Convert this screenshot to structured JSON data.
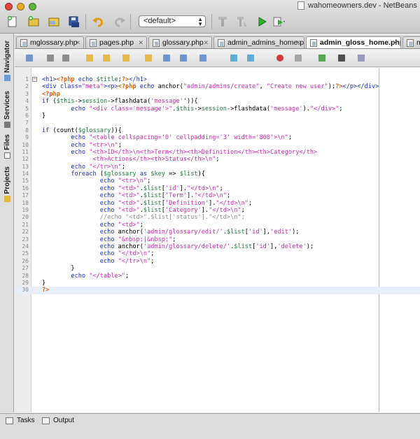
{
  "window": {
    "title": "wahomeowners.dev - NetBeans I"
  },
  "toolbar": {
    "config": "<default>",
    "icons": [
      "new-file-icon",
      "new-project-icon",
      "open-project-icon",
      "save-all-icon",
      "undo-icon",
      "redo-icon",
      "build-icon",
      "clean-build-icon",
      "run-icon",
      "debug-icon"
    ]
  },
  "sidebar": {
    "tabs": [
      "Navigator",
      "Services",
      "Files",
      "Projects"
    ]
  },
  "tabs": [
    {
      "label": "mglossary.php",
      "active": false
    },
    {
      "label": "pages.php",
      "active": false
    },
    {
      "label": "glossary.php",
      "active": false
    },
    {
      "label": "admin_admins_home.php",
      "active": false
    },
    {
      "label": "admin_gloss_home.php",
      "active": true
    },
    {
      "label": "msub",
      "active": false
    }
  ],
  "editor_toolbar": {
    "icons": [
      "last-edit-icon",
      "back-icon",
      "forward-icon",
      "find-icon",
      "find-prev-icon",
      "find-next-icon",
      "toggle-highlight-icon",
      "prev-bookmark-icon",
      "next-bookmark-icon",
      "toggle-bookmark-icon",
      "shift-left-icon",
      "shift-right-icon",
      "start-macro-icon",
      "stop-macro-icon",
      "diff-icon",
      "chart-icon",
      "database-icon"
    ]
  },
  "code": {
    "current_line": 30,
    "lines": [
      [
        [
          "h",
          "<h1>"
        ],
        [
          "p",
          "<?php"
        ],
        [
          "k",
          " echo "
        ],
        [
          "v",
          "$title"
        ],
        [
          "o",
          ";"
        ],
        [
          "p",
          "?>"
        ],
        [
          "h",
          "</h1>"
        ]
      ],
      [
        [
          "h",
          "<div "
        ],
        [
          "h",
          "class="
        ],
        [
          "s",
          "\"meta\""
        ],
        [
          "h",
          "><p>"
        ],
        [
          "p",
          "<?php"
        ],
        [
          "k",
          " echo "
        ],
        [
          "o",
          "anchor("
        ],
        [
          "s",
          "\"admin/admins/create\""
        ],
        [
          "o",
          ", "
        ],
        [
          "s",
          "\"Create new user\""
        ],
        [
          "o",
          ");"
        ],
        [
          "p",
          "?>"
        ],
        [
          "h",
          "</p></div>"
        ]
      ],
      [
        [
          "p",
          "<?php"
        ]
      ],
      [
        [
          "k",
          "if "
        ],
        [
          "o",
          "("
        ],
        [
          "v",
          "$this"
        ],
        [
          "o",
          "->"
        ],
        [
          "v",
          "session"
        ],
        [
          "o",
          "->flashdata("
        ],
        [
          "s",
          "'message'"
        ],
        [
          "o",
          "')){"
        ]
      ],
      [
        [
          "o",
          "        "
        ],
        [
          "k",
          "echo "
        ],
        [
          "s",
          "\"<div class='message'>\""
        ],
        [
          "o",
          "."
        ],
        [
          "v",
          "$this"
        ],
        [
          "o",
          "->"
        ],
        [
          "v",
          "session"
        ],
        [
          "o",
          "->flashdata("
        ],
        [
          "s",
          "'message'"
        ],
        [
          "o",
          ")."
        ],
        [
          "s",
          "\"</div>\""
        ],
        [
          "o",
          ";"
        ]
      ],
      [
        [
          "o",
          "}"
        ]
      ],
      [],
      [
        [
          "k",
          "if "
        ],
        [
          "o",
          "(count("
        ],
        [
          "v",
          "$glossary"
        ],
        [
          "o",
          ")){"
        ]
      ],
      [
        [
          "o",
          "        "
        ],
        [
          "k",
          "echo "
        ],
        [
          "s",
          "\"<table cellspacing='0' cellpadding='3' width='800'>\\n\""
        ],
        [
          "o",
          ";"
        ]
      ],
      [
        [
          "o",
          "        "
        ],
        [
          "k",
          "echo "
        ],
        [
          "s",
          "\"<tr>\\n\""
        ],
        [
          "o",
          ";"
        ]
      ],
      [
        [
          "o",
          "        "
        ],
        [
          "k",
          "echo "
        ],
        [
          "s",
          "\"<th>ID</th>\\n<th>Term</th><th>Definition</th><th>Category</th>"
        ]
      ],
      [
        [
          "s",
          "              <th>Actions</th><th>Status</th>\\n\""
        ],
        [
          "o",
          ";"
        ]
      ],
      [
        [
          "o",
          "        "
        ],
        [
          "k",
          "echo "
        ],
        [
          "s",
          "\"</tr>\\n\""
        ],
        [
          "o",
          ";"
        ]
      ],
      [
        [
          "o",
          "        "
        ],
        [
          "k",
          "foreach "
        ],
        [
          "o",
          "("
        ],
        [
          "v",
          "$glossary"
        ],
        [
          "k",
          " as "
        ],
        [
          "v",
          "$key"
        ],
        [
          "o",
          " => "
        ],
        [
          "v",
          "$list"
        ],
        [
          "o",
          "){"
        ]
      ],
      [
        [
          "o",
          "                "
        ],
        [
          "k",
          "echo "
        ],
        [
          "s",
          "\"<tr>\\n\""
        ],
        [
          "o",
          ";"
        ]
      ],
      [
        [
          "o",
          "                "
        ],
        [
          "k",
          "echo "
        ],
        [
          "s",
          "\"<td>\""
        ],
        [
          "o",
          "."
        ],
        [
          "v",
          "$list"
        ],
        [
          "o",
          "["
        ],
        [
          "s",
          "'id'"
        ],
        [
          "o",
          "]."
        ],
        [
          "s",
          "\"</td>\\n\""
        ],
        [
          "o",
          ";"
        ]
      ],
      [
        [
          "o",
          "                "
        ],
        [
          "k",
          "echo "
        ],
        [
          "s",
          "\"<td>\""
        ],
        [
          "o",
          "."
        ],
        [
          "v",
          "$list"
        ],
        [
          "o",
          "["
        ],
        [
          "s",
          "'Term'"
        ],
        [
          "o",
          "]."
        ],
        [
          "s",
          "\"</td>\\n\""
        ],
        [
          "o",
          ";"
        ]
      ],
      [
        [
          "o",
          "                "
        ],
        [
          "k",
          "echo "
        ],
        [
          "s",
          "\"<td>\""
        ],
        [
          "o",
          "."
        ],
        [
          "v",
          "$list"
        ],
        [
          "o",
          "["
        ],
        [
          "s",
          "'Definition'"
        ],
        [
          "o",
          "]."
        ],
        [
          "s",
          "\"</td>\\n\""
        ],
        [
          "o",
          ";"
        ]
      ],
      [
        [
          "o",
          "                "
        ],
        [
          "k",
          "echo "
        ],
        [
          "s",
          "\"<td>\""
        ],
        [
          "o",
          "."
        ],
        [
          "v",
          "$list"
        ],
        [
          "o",
          "["
        ],
        [
          "s",
          "'Category'"
        ],
        [
          "o",
          "]."
        ],
        [
          "s",
          "\"</td>\\n\""
        ],
        [
          "o",
          ";"
        ]
      ],
      [
        [
          "o",
          "                "
        ],
        [
          "c",
          "//echo \"<td>\".$list['status'].\"</td>\\n\";"
        ]
      ],
      [
        [
          "o",
          "                "
        ],
        [
          "k",
          "echo "
        ],
        [
          "s",
          "\"<td>\""
        ],
        [
          "o",
          ";"
        ]
      ],
      [
        [
          "o",
          "                "
        ],
        [
          "k",
          "echo "
        ],
        [
          "o",
          "anchor("
        ],
        [
          "s",
          "'admin/glossary/edit/'"
        ],
        [
          "o",
          "."
        ],
        [
          "v",
          "$list"
        ],
        [
          "o",
          "["
        ],
        [
          "s",
          "'id'"
        ],
        [
          "o",
          "],"
        ],
        [
          "s",
          "'edit'"
        ],
        [
          "o",
          ");"
        ]
      ],
      [
        [
          "o",
          "                "
        ],
        [
          "k",
          "echo "
        ],
        [
          "s",
          "\"&nbsp;|&nbsp;\""
        ],
        [
          "o",
          ";"
        ]
      ],
      [
        [
          "o",
          "                "
        ],
        [
          "k",
          "echo "
        ],
        [
          "o",
          "anchor("
        ],
        [
          "s",
          "'admin/glossary/delete/'"
        ],
        [
          "o",
          "."
        ],
        [
          "v",
          "$list"
        ],
        [
          "o",
          "["
        ],
        [
          "s",
          "'id'"
        ],
        [
          "o",
          "],"
        ],
        [
          "s",
          "'delete'"
        ],
        [
          "o",
          ");"
        ]
      ],
      [
        [
          "o",
          "                "
        ],
        [
          "k",
          "echo "
        ],
        [
          "s",
          "\"</td>\\n\""
        ],
        [
          "o",
          ";"
        ]
      ],
      [
        [
          "o",
          "                "
        ],
        [
          "k",
          "echo "
        ],
        [
          "s",
          "\"</tr>\\n\""
        ],
        [
          "o",
          ";"
        ]
      ],
      [
        [
          "o",
          "        }"
        ]
      ],
      [
        [
          "o",
          "        "
        ],
        [
          "k",
          "echo "
        ],
        [
          "s",
          "\"</table>\""
        ],
        [
          "o",
          ";"
        ]
      ],
      [
        [
          "o",
          "}"
        ]
      ],
      [
        [
          "p",
          "?>"
        ]
      ]
    ]
  },
  "bottom": {
    "tabs": [
      {
        "label": "Tasks"
      },
      {
        "label": "Output"
      }
    ]
  }
}
